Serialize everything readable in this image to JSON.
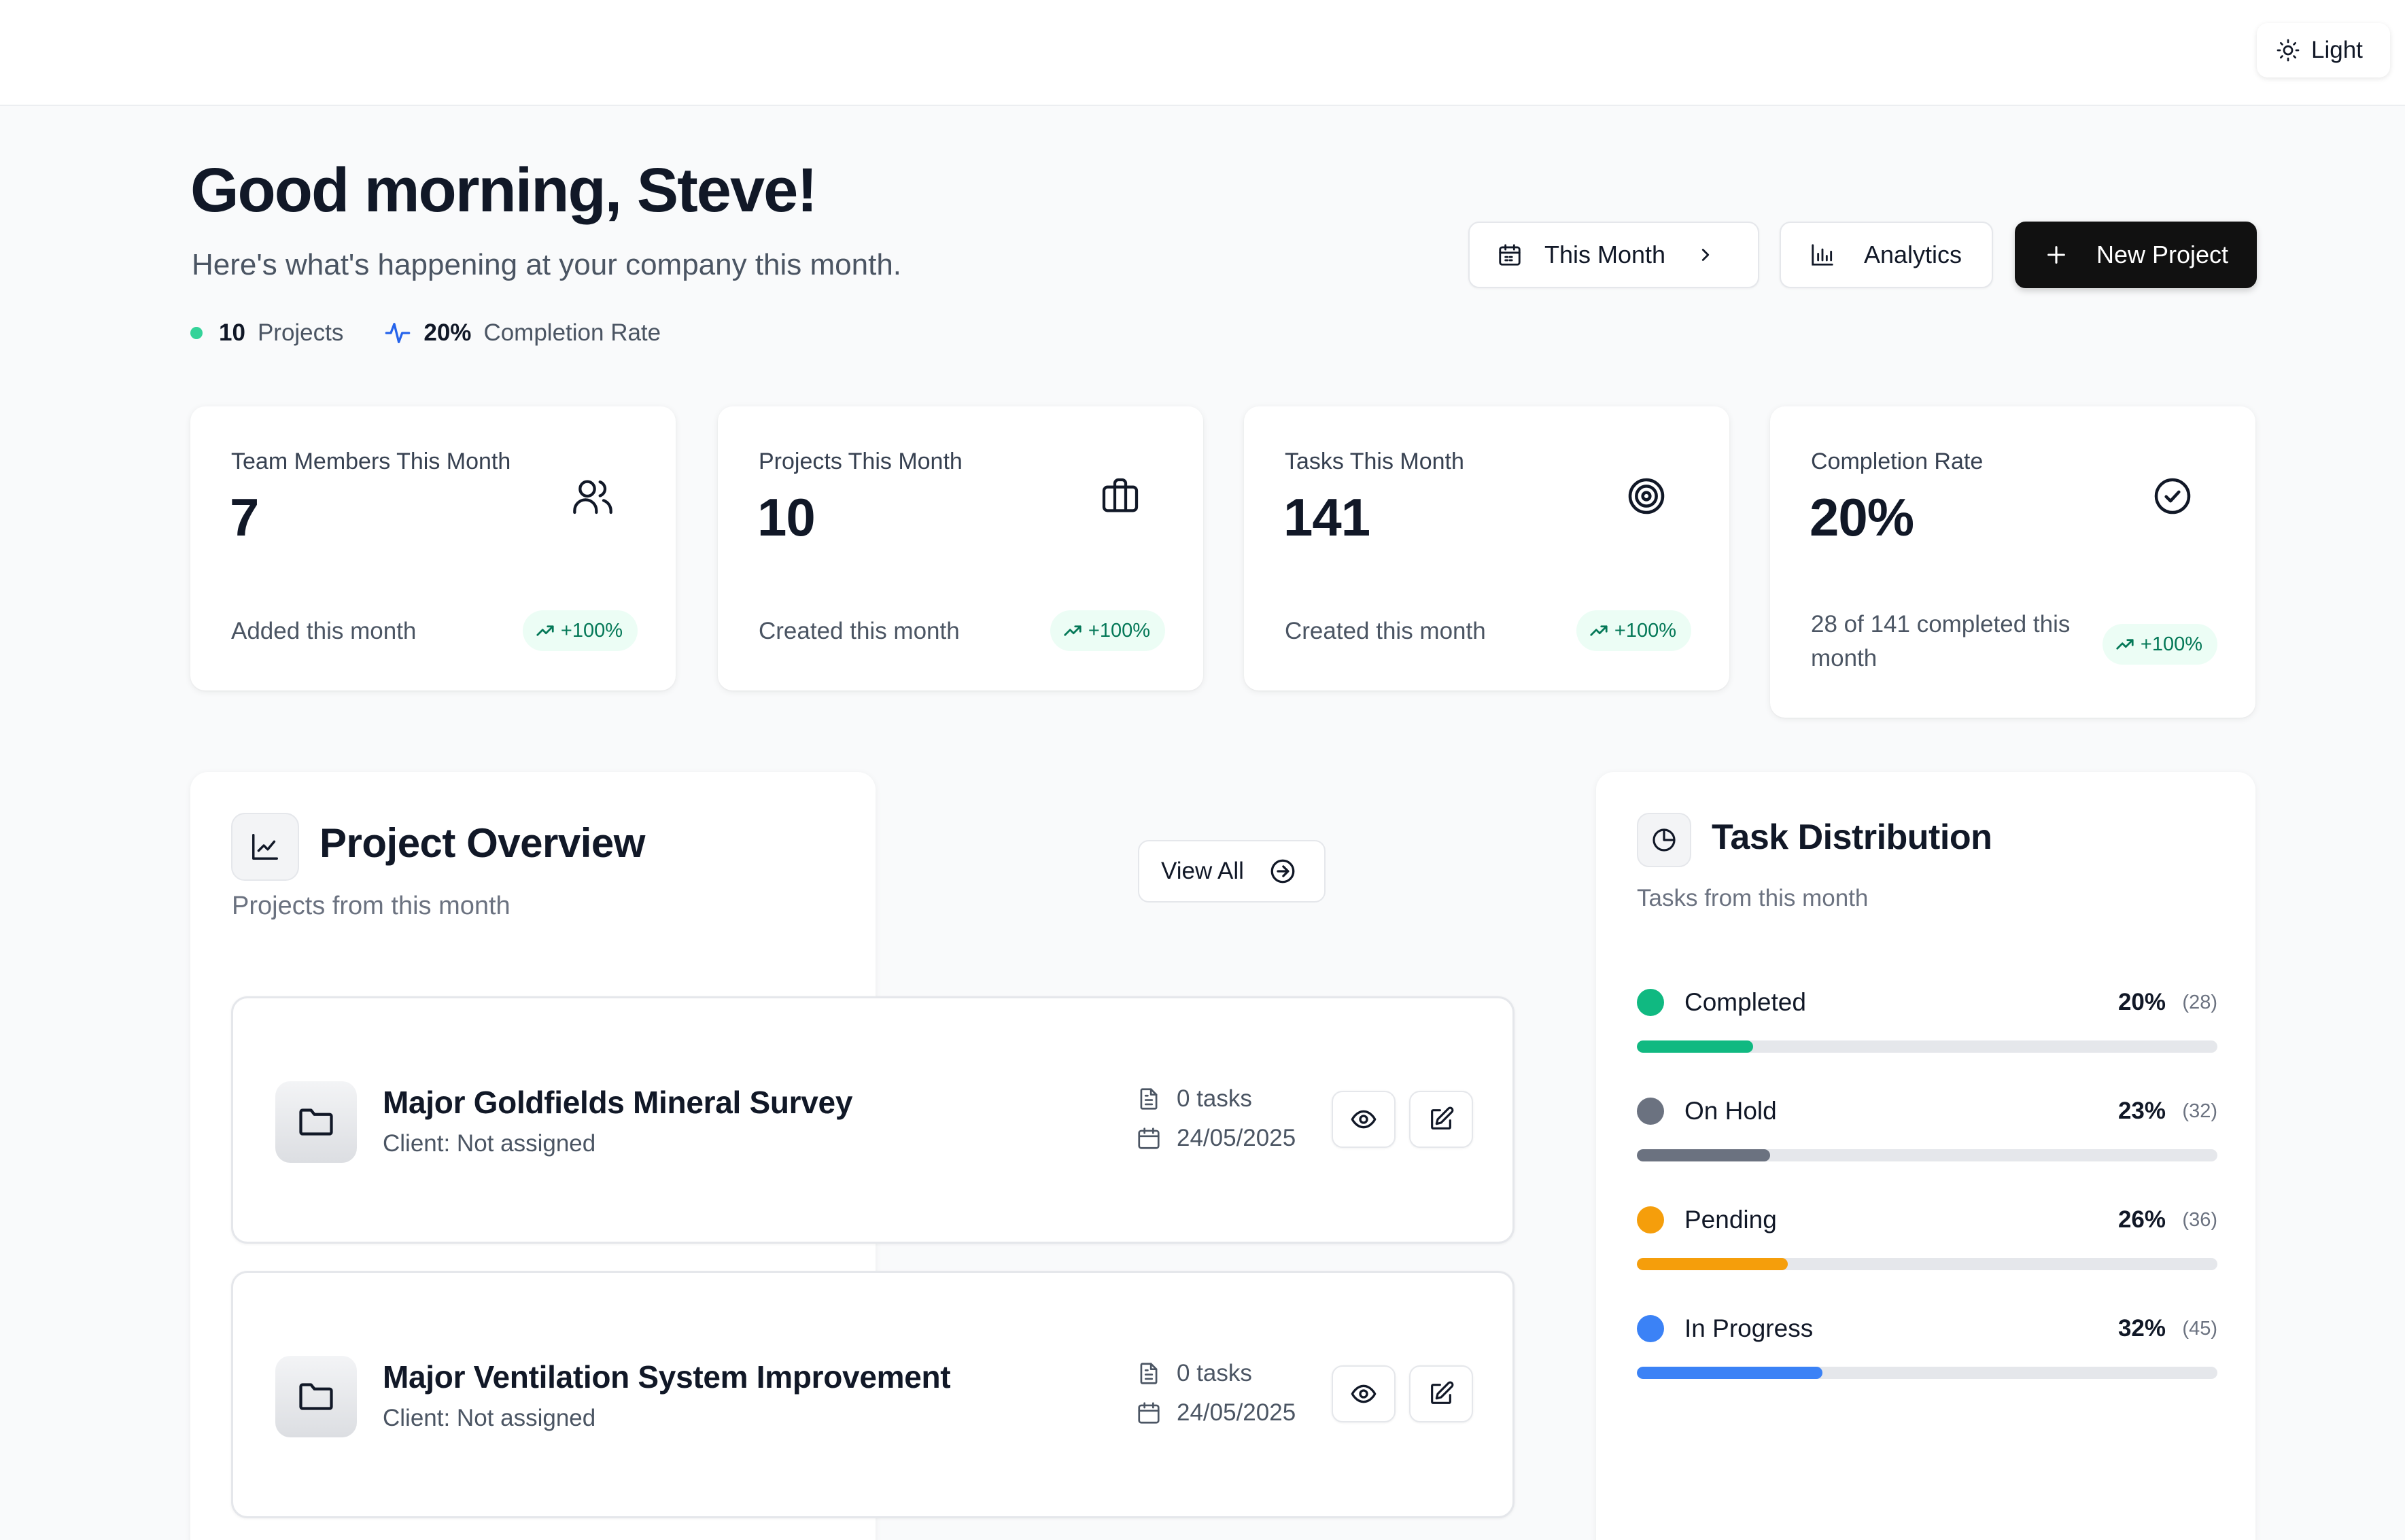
{
  "theme": {
    "label": "Light"
  },
  "header": {
    "greeting": "Good morning, Steve!",
    "subtitle": "Here's what's happening at your company this month.",
    "summary": {
      "projects_count": "10",
      "projects_label": "Projects",
      "completion_value": "20%",
      "completion_label": "Completion Rate"
    },
    "buttons": {
      "period": "This Month",
      "analytics": "Analytics",
      "new_project": "New Project"
    }
  },
  "stats": [
    {
      "label": "Team Members This Month",
      "value": "7",
      "footer": "Added this month",
      "trend": "+100%",
      "icon": "users-icon"
    },
    {
      "label": "Projects This Month",
      "value": "10",
      "footer": "Created this month",
      "trend": "+100%",
      "icon": "briefcase-icon"
    },
    {
      "label": "Tasks This Month",
      "value": "141",
      "footer": "Created this month",
      "trend": "+100%",
      "icon": "target-icon"
    },
    {
      "label": "Completion Rate",
      "value": "20%",
      "footer": "28 of 141 completed this month",
      "trend": "+100%",
      "icon": "check-circle-icon"
    }
  ],
  "overview": {
    "title": "Project Overview",
    "subtitle": "Projects from this month",
    "view_all": "View All",
    "projects": [
      {
        "name": "Major Goldfields Mineral Survey",
        "client": "Client: Not assigned",
        "tasks": "0 tasks",
        "date": "24/05/2025"
      },
      {
        "name": "Major Ventilation System Improvement",
        "client": "Client: Not assigned",
        "tasks": "0 tasks",
        "date": "24/05/2025"
      }
    ]
  },
  "distribution": {
    "title": "Task Distribution",
    "subtitle": "Tasks from this month",
    "items": [
      {
        "label": "Completed",
        "percent": "20%",
        "count": "(28)",
        "fraction": 0.2,
        "color": "#10b981"
      },
      {
        "label": "On Hold",
        "percent": "23%",
        "count": "(32)",
        "fraction": 0.23,
        "color": "#6b7280"
      },
      {
        "label": "Pending",
        "percent": "26%",
        "count": "(36)",
        "fraction": 0.26,
        "color": "#f59e0b"
      },
      {
        "label": "In Progress",
        "percent": "32%",
        "count": "(45)",
        "fraction": 0.32,
        "color": "#3b82f6"
      }
    ]
  },
  "colors": {
    "accent": "#111111",
    "trend_bg": "#ecfdf5",
    "trend_text": "#047857",
    "pulse": "#2563eb",
    "status_dot": "#34d399"
  }
}
